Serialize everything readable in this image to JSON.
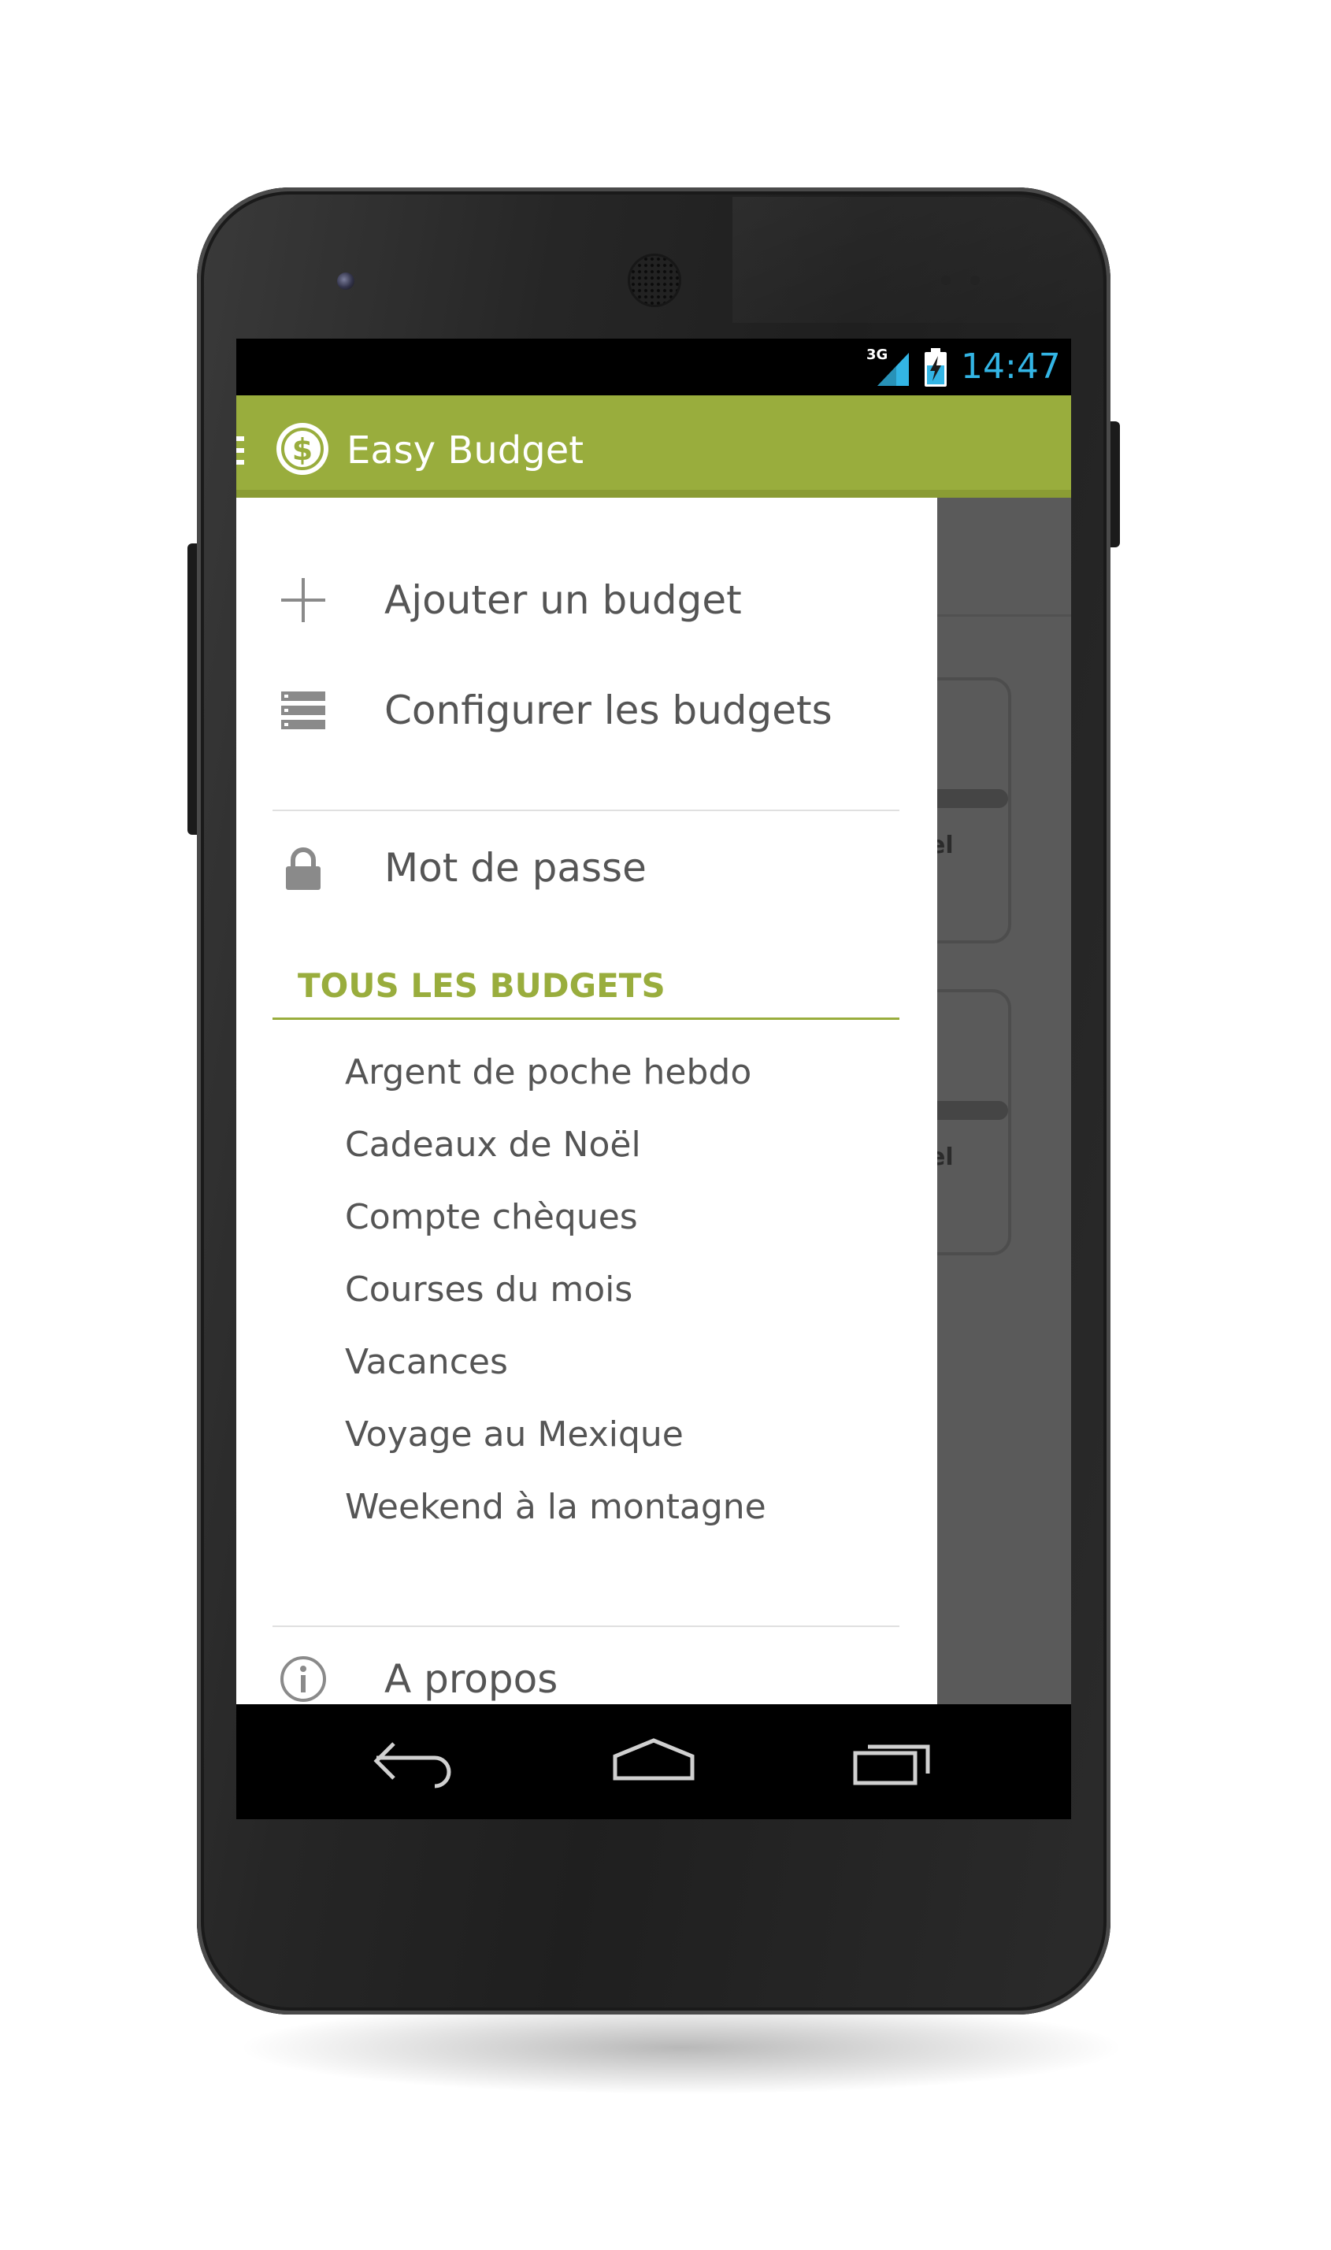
{
  "status_bar": {
    "network": "3G",
    "time": "14:47",
    "signal_icon": "signal-icon",
    "battery_icon": "battery-charging-icon",
    "time_color": "#33b5e5"
  },
  "action_bar": {
    "title": "Easy Budget",
    "logo_icon": "dollar-coin-icon",
    "drawer_indicator_icon": "drawer-indicator-icon",
    "color": "#99ad3d"
  },
  "drawer": {
    "actions": [
      {
        "label": "Ajouter un budget",
        "icon": "plus-icon"
      },
      {
        "label": "Configurer les budgets",
        "icon": "list-icon"
      },
      {
        "label": "Mot de passe",
        "icon": "lock-icon"
      }
    ],
    "section_header": "TOUS LES BUDGETS",
    "budgets": [
      "Argent de poche hebdo",
      "Cadeaux de Noël",
      "Compte chèques",
      "Courses du mois",
      "Vacances",
      "Voyage au Mexique",
      "Weekend à la montagne"
    ],
    "footer": {
      "label": "A propos",
      "icon": "info-icon"
    }
  },
  "background_content": {
    "card_labels": [
      "el",
      "el"
    ]
  },
  "nav_bar": {
    "back_icon": "back-icon",
    "home_icon": "home-icon",
    "recents_icon": "recent-apps-icon"
  }
}
